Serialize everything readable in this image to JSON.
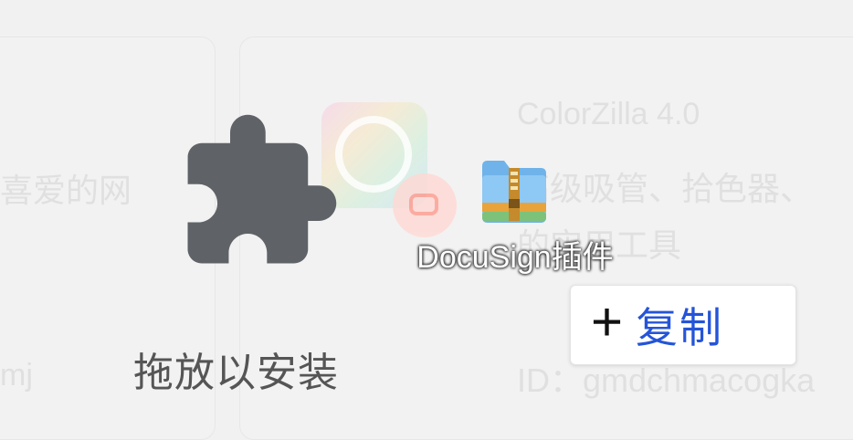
{
  "background": {
    "extension_title": "ColorZilla  4.0",
    "description_line1": "高级吸管、拾色器、",
    "description_line2": "的实用工具",
    "id_text": "ID：gmdchmacogka",
    "left_text1": "喜爱的网",
    "left_text2": "mj"
  },
  "drop_hint": {
    "icon": "puzzle-piece-icon",
    "label": "拖放以安装"
  },
  "dragged_file": {
    "icon": "winrar-archive-icon",
    "label": "DocuSign插件"
  },
  "drag_tooltip": {
    "icon": "plus-icon",
    "label": "复制"
  },
  "colors": {
    "icon_gray": "#5f6368",
    "copy_blue": "#2454d8"
  }
}
